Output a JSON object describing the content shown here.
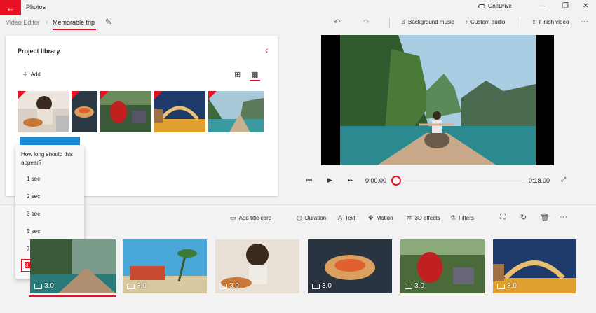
{
  "app": {
    "title": "Photos",
    "onedrive": "OneDrive"
  },
  "window": {
    "minimize": "—",
    "restore": "❐",
    "close": "✕"
  },
  "breadcrumb": {
    "parent": "Video Editor",
    "current": "Memorable trip"
  },
  "toolbar": {
    "undo": "↶",
    "redo": "↷",
    "background_music": "Background music",
    "custom_audio": "Custom audio",
    "finish_video": "Finish video",
    "more": "···"
  },
  "library": {
    "title": "Project library",
    "add_label": "Add",
    "collapse": "‹"
  },
  "duration_popup": {
    "question": "How long should this appear?",
    "options": [
      "1 sec",
      "2 sec",
      "3 sec",
      "5 sec",
      "7 sec"
    ],
    "value": "3.0",
    "unit": "sec",
    "clear": "✕"
  },
  "player": {
    "current_time": "0:00.00",
    "total_time": "0:18.00",
    "progress": 0
  },
  "storyboard": {
    "toolbar": {
      "add_title_card": "Add title card",
      "duration": "Duration",
      "text": "Text",
      "motion": "Motion",
      "effects_3d": "3D effects",
      "filters": "Filters",
      "more": "···"
    },
    "clips": [
      {
        "duration": "3.0"
      },
      {
        "duration": "3.0"
      },
      {
        "duration": "3.0"
      },
      {
        "duration": "3.0"
      },
      {
        "duration": "3.0"
      },
      {
        "duration": "3.0"
      }
    ]
  },
  "colors": {
    "accent": "#e81123",
    "info": "#1a8ad6"
  }
}
